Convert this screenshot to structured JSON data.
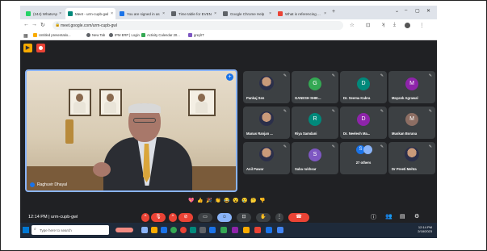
{
  "browser": {
    "tabs": [
      {
        "label": "(244) WhatsApp",
        "color": "#25d366"
      },
      {
        "label": "Meet - urm-cupb-gwl",
        "color": "#00897b",
        "active": true
      },
      {
        "label": "You are signed in as ...",
        "color": "#1a73e8"
      },
      {
        "label": "Time table for EVEN ...",
        "color": "#5f6368"
      },
      {
        "label": "Google Chrome Help",
        "color": "#5f6368"
      },
      {
        "label": "What is referencing ...",
        "color": "#ea4335"
      }
    ],
    "new_tab": "+",
    "url": "meet.google.com/urm-cupb-gwl",
    "bookmarks": [
      {
        "label": "Untitled presentatio...",
        "color": "#f9ab00"
      },
      {
        "label": "New Tab",
        "color": "#5f6368"
      },
      {
        "label": "IPM ERP | Login",
        "color": "#5f6368"
      },
      {
        "label": "Activity Calendar 20...",
        "color": "#34a853"
      },
      {
        "label": "greylIT",
        "color": "#7e57c2"
      }
    ]
  },
  "meeting": {
    "speaker_name": "Raghuvir Dhayal",
    "participants": [
      {
        "name": "Pankaj Sen",
        "initial": "",
        "photo": true,
        "color": "#3c4043"
      },
      {
        "name": "GANESH SHIK...",
        "initial": "G",
        "color": "#34a853"
      },
      {
        "name": "Dr. Seema Kabra",
        "initial": "D",
        "color": "#00897b"
      },
      {
        "name": "Mayank Agrawal",
        "initial": "M",
        "color": "#8e24aa"
      },
      {
        "name": "Manas Ranjan ...",
        "initial": "",
        "photo": true,
        "color": "#3c4043"
      },
      {
        "name": "Riya Samdani",
        "initial": "R",
        "color": "#00897b"
      },
      {
        "name": "Dr. Neelesh Ma...",
        "initial": "D",
        "color": "#8e24aa"
      },
      {
        "name": "Muskan Borana",
        "initial": "M",
        "color": "#8d6e63"
      },
      {
        "name": "Anil Pawar",
        "initial": "",
        "photo": true,
        "color": "#3c4043"
      },
      {
        "name": "Saba rukhsar",
        "initial": "S",
        "color": "#7e57c2"
      },
      {
        "name": "27 others",
        "initial": "S",
        "color": "#1a73e8",
        "others": true
      },
      {
        "name": "Dr Preeti Mehta",
        "initial": "",
        "photo": true,
        "color": "#3c4043"
      }
    ],
    "time_code": "12:14 PM | urm-cupb-gwl",
    "reactions": [
      "💖",
      "👍",
      "🎉",
      "👏",
      "😂",
      "😮",
      "😢",
      "🤔",
      "👎"
    ]
  },
  "taskbar": {
    "search_placeholder": "Type here to search",
    "clock_time": "12:14 PM",
    "clock_date": "2/18/2023"
  }
}
